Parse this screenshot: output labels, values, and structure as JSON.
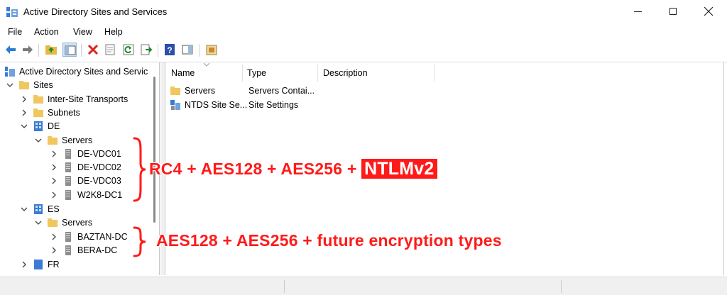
{
  "window": {
    "title": "Active Directory Sites and Services",
    "icon": "ad-sites-icon"
  },
  "menu": [
    "File",
    "Action",
    "View",
    "Help"
  ],
  "toolbar": {
    "buttons": [
      "back-icon",
      "forward-icon",
      "up-folder-icon",
      "show-hide-console-tree-icon",
      "delete-icon",
      "properties-icon",
      "refresh-icon",
      "export-list-icon",
      "help-icon",
      "action-pane-icon",
      "new-site-icon"
    ]
  },
  "tree": {
    "root": "Active Directory Sites and Servic",
    "sites": "Sites",
    "inter_site": "Inter-Site Transports",
    "subnets": "Subnets",
    "de": "DE",
    "de_servers": "Servers",
    "de_dcs": [
      "DE-VDC01",
      "DE-VDC02",
      "DE-VDC03",
      "W2K8-DC1"
    ],
    "es": "ES",
    "es_servers": "Servers",
    "es_dcs": [
      "BAZTAN-DC",
      "BERA-DC"
    ],
    "cut": "FR"
  },
  "list": {
    "columns": [
      "Name",
      "Type",
      "Description"
    ],
    "rows": [
      {
        "name": "Servers",
        "type": "Servers Contai...",
        "description": ""
      },
      {
        "name": "NTDS Site Se...",
        "type": "Site Settings",
        "description": ""
      }
    ]
  },
  "annotations": {
    "top_text": "RC4 + AES128 + AES256  +",
    "top_box": "NTLMv2",
    "bottom_text": "AES128 + AES256 + future encryption types",
    "color": "#ff1a1a"
  }
}
